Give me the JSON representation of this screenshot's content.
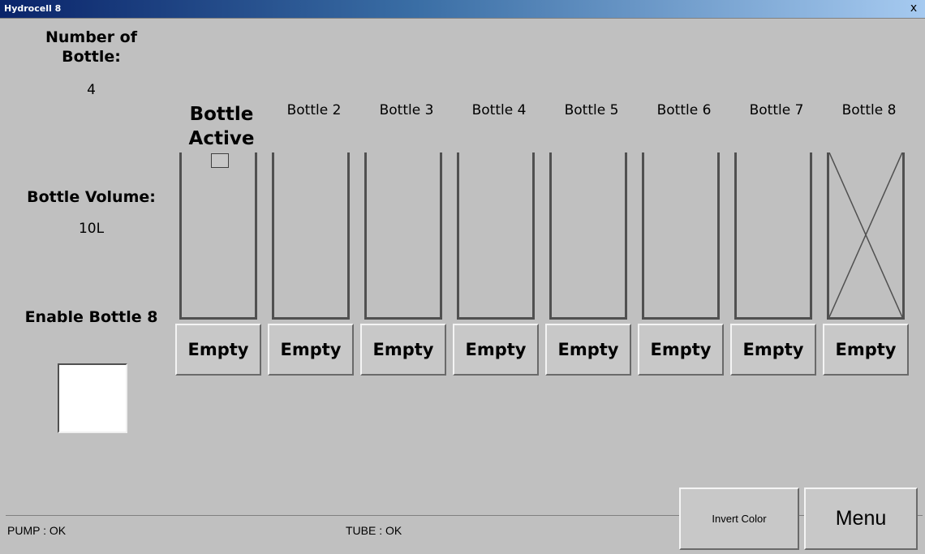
{
  "window": {
    "title": "Hydrocell 8",
    "close_label": "x"
  },
  "left_panel": {
    "count_label": "Number of Bottle:",
    "count_value": "4",
    "volume_label": "Bottle Volume:",
    "volume_value": "10L",
    "enable_label": "Enable Bottle 8"
  },
  "bottles": [
    {
      "label": "Bottle Active",
      "state": "Empty",
      "active": true
    },
    {
      "label": "Bottle 2",
      "state": "Empty"
    },
    {
      "label": "Bottle 3",
      "state": "Empty"
    },
    {
      "label": "Bottle 4",
      "state": "Empty"
    },
    {
      "label": "Bottle 5",
      "state": "Empty"
    },
    {
      "label": "Bottle 6",
      "state": "Empty"
    },
    {
      "label": "Bottle 7",
      "state": "Empty"
    },
    {
      "label": "Bottle 8",
      "state": "Empty",
      "disabled": true
    }
  ],
  "status": {
    "pump": "PUMP : OK",
    "tube": "TUBE : OK"
  },
  "buttons": {
    "invert": "Invert Color",
    "menu": "Menu"
  }
}
